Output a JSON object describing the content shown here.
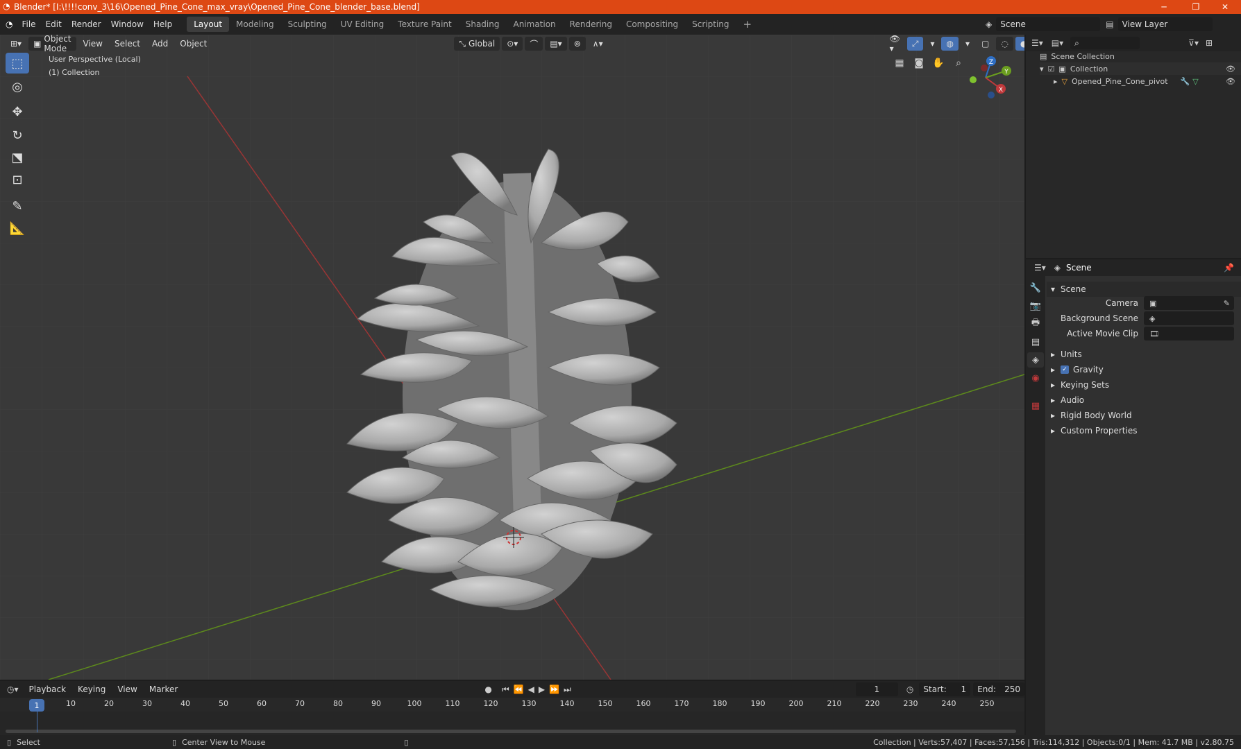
{
  "titlebar": {
    "title": "Blender* [I:\\!!!!conv_3\\16\\Opened_Pine_Cone_max_vray\\Opened_Pine_Cone_blender_base.blend]"
  },
  "menu": [
    "File",
    "Edit",
    "Render",
    "Window",
    "Help"
  ],
  "workspaces": [
    "Layout",
    "Modeling",
    "Sculpting",
    "UV Editing",
    "Texture Paint",
    "Shading",
    "Animation",
    "Rendering",
    "Compositing",
    "Scripting"
  ],
  "scene_field": "Scene",
  "view_layer_field": "View Layer",
  "viewport": {
    "mode": "Object Mode",
    "menus": [
      "View",
      "Select",
      "Add",
      "Object"
    ],
    "transform": "Global",
    "overlay_title": "User Perspective (Local)",
    "overlay_collection": "(1) Collection",
    "axis_x": "X",
    "axis_y": "Y",
    "axis_z": "Z"
  },
  "outliner": {
    "root": "Scene Collection",
    "collection": "Collection",
    "object": "Opened_Pine_Cone_pivot"
  },
  "properties": {
    "header": "Scene",
    "panel": "Scene",
    "fields": [
      {
        "label": "Camera"
      },
      {
        "label": "Background Scene"
      },
      {
        "label": "Active Movie Clip"
      }
    ],
    "sections": [
      "Units",
      "Gravity",
      "Keying Sets",
      "Audio",
      "Rigid Body World",
      "Custom Properties"
    ]
  },
  "timeline": {
    "menus": [
      "Playback",
      "Keying",
      "View",
      "Marker"
    ],
    "current_frame": "1",
    "start_label": "Start:",
    "start": "1",
    "end_label": "End:",
    "end": "250",
    "ticks": [
      "10",
      "20",
      "30",
      "40",
      "50",
      "60",
      "70",
      "80",
      "90",
      "100",
      "110",
      "120",
      "130",
      "140",
      "150",
      "160",
      "170",
      "180",
      "190",
      "200",
      "210",
      "220",
      "230",
      "240",
      "250"
    ],
    "playhead": "1"
  },
  "statusbar": {
    "left": "Select",
    "middle": "Center View to Mouse",
    "right": "Collection | Verts:57,407 | Faces:57,156 | Tris:114,312 | Objects:0/1 | Mem: 41.7 MB | v2.80.75"
  },
  "colors": {
    "titlebar": "#dd4814",
    "accent": "#4772b3",
    "x_axis": "#c0393b",
    "y_axis": "#6b9e1f"
  }
}
